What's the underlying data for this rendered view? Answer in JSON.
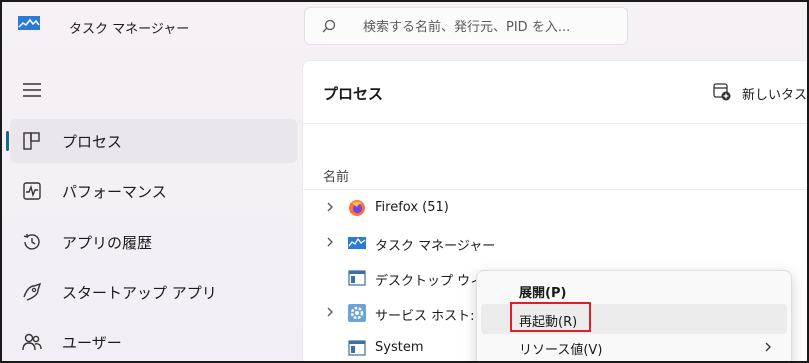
{
  "window": {
    "title": "タスク マネージャー",
    "icon": "task-manager-icon"
  },
  "search": {
    "placeholder": "検索する名前、発行元、PID を入..."
  },
  "sidebar": {
    "items": [
      {
        "label": "プロセス",
        "icon": "processes-icon",
        "selected": true
      },
      {
        "label": "パフォーマンス",
        "icon": "performance-icon",
        "selected": false
      },
      {
        "label": "アプリの履歴",
        "icon": "app-history-icon",
        "selected": false
      },
      {
        "label": "スタートアップ アプリ",
        "icon": "startup-apps-icon",
        "selected": false
      },
      {
        "label": "ユーザー",
        "icon": "users-icon",
        "selected": false
      }
    ]
  },
  "main": {
    "page_title": "プロセス",
    "new_task_label": "新しいタスク",
    "column_name_header": "名前",
    "rows": [
      {
        "label": "Firefox (51)",
        "icon": "firefox-icon",
        "expandable": true
      },
      {
        "label": "タスク マネージャー",
        "icon": "task-manager-icon",
        "expandable": true
      },
      {
        "label": "デスクトップ ウィンドウ マネージャー",
        "icon": "window-icon",
        "expandable": false
      },
      {
        "label": "サービス ホスト: Bl",
        "icon": "gear-icon",
        "expandable": true
      },
      {
        "label": "System",
        "icon": "window-icon",
        "expandable": false
      }
    ]
  },
  "context_menu": {
    "items": [
      {
        "label": "展開(P)",
        "bold": true
      },
      {
        "label": "再起動(R)",
        "highlighted": true
      },
      {
        "label": "リソース値(V)",
        "submenu": true
      }
    ]
  },
  "colors": {
    "accent": "#0f6b87",
    "highlight_border": "#d8212a",
    "firefox_orange": "#ff7139",
    "taskmgr_blue": "#2b7ad6"
  }
}
